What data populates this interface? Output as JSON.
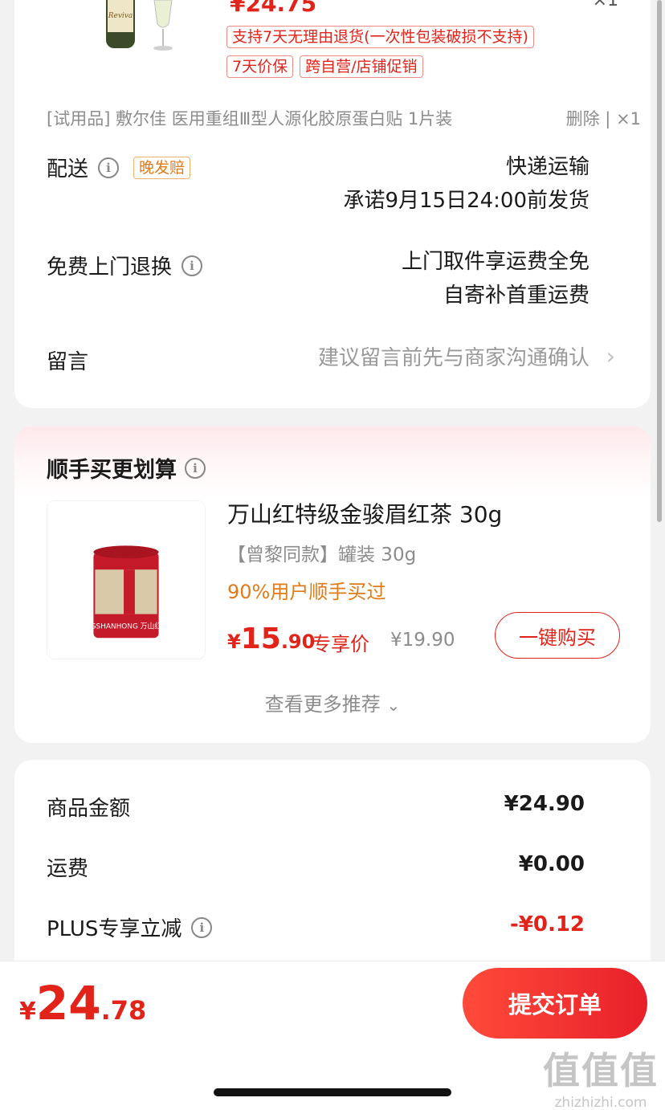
{
  "top_product": {
    "price": "¥24.75",
    "qty": "×1",
    "tags": [
      "支持7天无理由退货(一次性包装破损不支持)",
      "7天价保",
      "跨自营/店铺促销"
    ]
  },
  "gift": {
    "text": "[试用品] 敷尔佳 医用重组Ⅲ型人源化胶原蛋白贴 1片装",
    "actions": "删除 | ×1"
  },
  "delivery": {
    "label": "配送",
    "badge": "晚发赔",
    "method": "快递运输",
    "promise": "承诺9月15日24:00前发货"
  },
  "return_service": {
    "label": "免费上门退换",
    "line1": "上门取件享运费全免",
    "line2": "自寄补首重运费"
  },
  "note": {
    "label": "留言",
    "placeholder": "建议留言前先与商家沟通确认"
  },
  "addon": {
    "title": "顺手买更划算",
    "product_name": "万山红特级金骏眉红茶 30g",
    "spec": "【曾黎同款】罐装 30g",
    "bought_hint": "90%用户顺手买过",
    "price_yen": "¥",
    "price_int": "15",
    "price_dec": ".90",
    "exclusive_label": "专享价",
    "orig_price": "¥19.90",
    "buy_label": "一键购买",
    "more_label": "查看更多推荐"
  },
  "summary": {
    "rows": [
      {
        "label": "商品金额",
        "value": "¥24.90"
      },
      {
        "label": "运费",
        "value": "¥0.00"
      },
      {
        "label": "PLUS专享立减",
        "value": "-¥0.12"
      }
    ]
  },
  "bottom": {
    "yen": "¥",
    "int": "24",
    "dec": ".78",
    "submit_label": "提交订单"
  },
  "watermark": {
    "big": "值值值",
    "small": "zhizhizhi.com"
  },
  "colors": {
    "accent": "#e2231a",
    "orange": "#e07b1a"
  }
}
